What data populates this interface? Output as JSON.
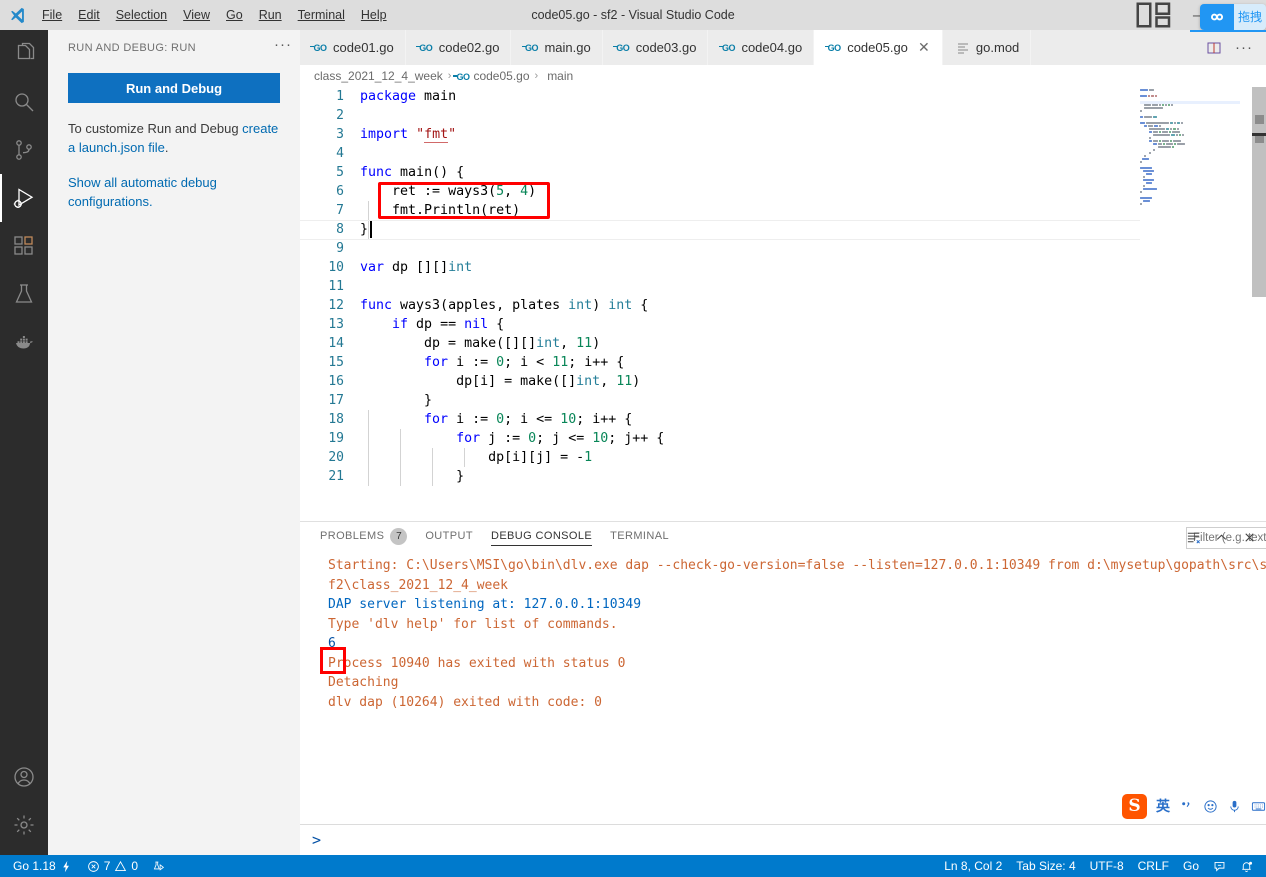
{
  "titlebar": {
    "window_title": "code05.go - sf2 - Visual Studio Code",
    "menus": [
      "File",
      "Edit",
      "Selection",
      "View",
      "Go",
      "Run",
      "Terminal",
      "Help"
    ],
    "layout_icon": "layout-panel-icon",
    "minimize_icon": "minimize-icon",
    "maximize_icon": "maximize-icon",
    "drag_widget": {
      "icon": "cloud-drag-icon",
      "label": "拖拽"
    }
  },
  "activitybar": {
    "items": [
      {
        "name": "explorer",
        "icon": "files-icon",
        "active": false
      },
      {
        "name": "search",
        "icon": "search-icon",
        "active": false
      },
      {
        "name": "source-control",
        "icon": "source-control-icon",
        "active": false
      },
      {
        "name": "run-and-debug",
        "icon": "run-debug-icon",
        "active": true
      },
      {
        "name": "extensions",
        "icon": "extensions-icon",
        "active": false
      },
      {
        "name": "testing",
        "icon": "beaker-icon",
        "active": false
      },
      {
        "name": "docker",
        "icon": "docker-icon",
        "active": false
      }
    ],
    "bottom": [
      {
        "name": "accounts",
        "icon": "account-icon"
      },
      {
        "name": "settings",
        "icon": "gear-icon"
      }
    ]
  },
  "sidebar": {
    "header_title": "RUN AND DEBUG: RUN",
    "more_actions": "···",
    "run_button_label": "Run and Debug",
    "customize_text_1": "To customize Run and Debug ",
    "customize_link": "create a launch.json file",
    "customize_text_2": ".",
    "show_all_link": "Show all automatic debug configurations."
  },
  "tabs": [
    {
      "label": "code01.go",
      "icon": "go-file-icon",
      "active": false,
      "closable": false
    },
    {
      "label": "code02.go",
      "icon": "go-file-icon",
      "active": false,
      "closable": false
    },
    {
      "label": "main.go",
      "icon": "go-file-icon",
      "active": false,
      "closable": false
    },
    {
      "label": "code03.go",
      "icon": "go-file-icon",
      "active": false,
      "closable": false
    },
    {
      "label": "code04.go",
      "icon": "go-file-icon",
      "active": false,
      "closable": false
    },
    {
      "label": "code05.go",
      "icon": "go-file-icon",
      "active": true,
      "closable": true,
      "close_label": "✕"
    },
    {
      "label": "go.mod",
      "icon": "mod-file-icon",
      "active": false,
      "closable": false
    }
  ],
  "tab_actions": [
    {
      "name": "split-editor-button",
      "icon": "split-editor-icon"
    },
    {
      "name": "more-actions-button",
      "icon": "ellipsis-icon",
      "label": "···"
    }
  ],
  "breadcrumbs": [
    {
      "label": "class_2021_12_4_week",
      "icon": ""
    },
    {
      "label": "code05.go",
      "icon": "go-file-icon"
    },
    {
      "label": "main",
      "icon": "symbol-namespace-icon"
    }
  ],
  "editor": {
    "cursor_position": "Ln 8, Col 2",
    "highlight_box": {
      "color": "#ff0000",
      "covers_lines": [
        6,
        7
      ]
    },
    "lines": [
      {
        "n": 1,
        "tokens": [
          {
            "t": "package",
            "c": "kw"
          },
          {
            "t": " main",
            "c": ""
          }
        ]
      },
      {
        "n": 2,
        "tokens": []
      },
      {
        "n": 3,
        "tokens": [
          {
            "t": "import",
            "c": "kw"
          },
          {
            "t": " ",
            "c": ""
          },
          {
            "t": "\"",
            "c": "str"
          },
          {
            "t": "fmt",
            "c": "imp"
          },
          {
            "t": "\"",
            "c": "str"
          }
        ]
      },
      {
        "n": 4,
        "tokens": []
      },
      {
        "n": 5,
        "tokens": [
          {
            "t": "func",
            "c": "kw"
          },
          {
            "t": " ",
            "c": ""
          },
          {
            "t": "main",
            "c": ""
          },
          {
            "t": "() {",
            "c": ""
          }
        ]
      },
      {
        "n": 6,
        "tokens": [
          {
            "t": "    ret := ",
            "c": ""
          },
          {
            "t": "ways3",
            "c": ""
          },
          {
            "t": "(",
            "c": ""
          },
          {
            "t": "5",
            "c": "num"
          },
          {
            "t": ", ",
            "c": ""
          },
          {
            "t": "4",
            "c": "num"
          },
          {
            "t": ")",
            "c": ""
          }
        ]
      },
      {
        "n": 7,
        "tokens": [
          {
            "t": "    fmt.Println(ret)",
            "c": ""
          }
        ]
      },
      {
        "n": 8,
        "tokens": [
          {
            "t": "}",
            "c": ""
          }
        ]
      },
      {
        "n": 9,
        "tokens": []
      },
      {
        "n": 10,
        "tokens": [
          {
            "t": "var",
            "c": "kw"
          },
          {
            "t": " dp [][]",
            "c": ""
          },
          {
            "t": "int",
            "c": "typ"
          }
        ]
      },
      {
        "n": 11,
        "tokens": []
      },
      {
        "n": 12,
        "tokens": [
          {
            "t": "func",
            "c": "kw"
          },
          {
            "t": " ways3(apples, plates ",
            "c": ""
          },
          {
            "t": "int",
            "c": "typ"
          },
          {
            "t": ") ",
            "c": ""
          },
          {
            "t": "int",
            "c": "typ"
          },
          {
            "t": " {",
            "c": ""
          }
        ]
      },
      {
        "n": 13,
        "tokens": [
          {
            "t": "    ",
            "c": ""
          },
          {
            "t": "if",
            "c": "kw"
          },
          {
            "t": " dp == ",
            "c": ""
          },
          {
            "t": "nil",
            "c": "kw"
          },
          {
            "t": " {",
            "c": ""
          }
        ]
      },
      {
        "n": 14,
        "tokens": [
          {
            "t": "        dp = make([][]",
            "c": ""
          },
          {
            "t": "int",
            "c": "typ"
          },
          {
            "t": ", ",
            "c": ""
          },
          {
            "t": "11",
            "c": "num"
          },
          {
            "t": ")",
            "c": ""
          }
        ]
      },
      {
        "n": 15,
        "tokens": [
          {
            "t": "        ",
            "c": ""
          },
          {
            "t": "for",
            "c": "kw"
          },
          {
            "t": " i := ",
            "c": ""
          },
          {
            "t": "0",
            "c": "num"
          },
          {
            "t": "; i < ",
            "c": ""
          },
          {
            "t": "11",
            "c": "num"
          },
          {
            "t": "; i++ {",
            "c": ""
          }
        ]
      },
      {
        "n": 16,
        "tokens": [
          {
            "t": "            dp[i] = make([]",
            "c": ""
          },
          {
            "t": "int",
            "c": "typ"
          },
          {
            "t": ", ",
            "c": ""
          },
          {
            "t": "11",
            "c": "num"
          },
          {
            "t": ")",
            "c": ""
          }
        ]
      },
      {
        "n": 17,
        "tokens": [
          {
            "t": "        }",
            "c": ""
          }
        ]
      },
      {
        "n": 18,
        "tokens": [
          {
            "t": "        ",
            "c": ""
          },
          {
            "t": "for",
            "c": "kw"
          },
          {
            "t": " i := ",
            "c": ""
          },
          {
            "t": "0",
            "c": "num"
          },
          {
            "t": "; i <= ",
            "c": ""
          },
          {
            "t": "10",
            "c": "num"
          },
          {
            "t": "; i++ {",
            "c": ""
          }
        ]
      },
      {
        "n": 19,
        "tokens": [
          {
            "t": "            ",
            "c": ""
          },
          {
            "t": "for",
            "c": "kw"
          },
          {
            "t": " j := ",
            "c": ""
          },
          {
            "t": "0",
            "c": "num"
          },
          {
            "t": "; j <= ",
            "c": ""
          },
          {
            "t": "10",
            "c": "num"
          },
          {
            "t": "; j++ {",
            "c": ""
          }
        ]
      },
      {
        "n": 20,
        "tokens": [
          {
            "t": "                dp[i][j] = -",
            "c": ""
          },
          {
            "t": "1",
            "c": "num"
          }
        ]
      },
      {
        "n": 21,
        "tokens": [
          {
            "t": "            }",
            "c": ""
          }
        ]
      }
    ]
  },
  "panel": {
    "tabs": [
      {
        "label": "PROBLEMS",
        "badge": "7",
        "active": false
      },
      {
        "label": "OUTPUT",
        "badge": null,
        "active": false
      },
      {
        "label": "DEBUG CONSOLE",
        "badge": null,
        "active": true
      },
      {
        "label": "TERMINAL",
        "badge": null,
        "active": false
      }
    ],
    "filter_placeholder": "Filter (e.g. text, !exclude)",
    "filter_value": "",
    "actions": [
      {
        "name": "clear-console-button",
        "icon": "clear-all-icon"
      },
      {
        "name": "collapse-panel-button",
        "icon": "chevron-up-icon"
      },
      {
        "name": "close-panel-button",
        "icon": "close-icon"
      }
    ],
    "console_lines": [
      {
        "text": "Starting: C:\\Users\\MSI\\go\\bin\\dlv.exe dap --check-go-version=false --listen=127.0.0.1:10349 from d:\\mysetup\\gopath\\src\\s",
        "kind": "normal"
      },
      {
        "text": "f2\\class_2021_12_4_week",
        "kind": "normal"
      },
      {
        "text": "DAP server listening at: 127.0.0.1:10349",
        "kind": "info"
      },
      {
        "text": "Type 'dlv help' for list of commands.",
        "kind": "normal"
      },
      {
        "text": "6",
        "kind": "value"
      },
      {
        "text": "Process 10940 has exited with status 0",
        "kind": "normal"
      },
      {
        "text": "Detaching",
        "kind": "normal"
      },
      {
        "text": "dlv dap (10264) exited with code: 0",
        "kind": "normal"
      }
    ],
    "highlighted_output": "6",
    "input_prompt": ">"
  },
  "ime": {
    "logo": "S",
    "mode_label": "英",
    "punctuation_icon": "punctuation-icon",
    "emoji_icon": "emoji-icon",
    "mic_icon": "microphone-icon",
    "keyboard_icon": "keyboard-icon"
  },
  "statusbar": {
    "left": [
      {
        "name": "go-version",
        "label": "Go 1.18",
        "icon": "zap-icon"
      },
      {
        "name": "problems",
        "label": "7",
        "icon": "error-icon",
        "label2": "0",
        "icon2": "warning-icon"
      },
      {
        "name": "go-test",
        "label": "",
        "icon": "beaker-run-icon"
      }
    ],
    "right": [
      {
        "name": "cursor-position",
        "label": "Ln 8, Col 2"
      },
      {
        "name": "tab-size",
        "label": "Tab Size: 4"
      },
      {
        "name": "encoding",
        "label": "UTF-8"
      },
      {
        "name": "eol",
        "label": "CRLF"
      },
      {
        "name": "language-mode",
        "label": "Go"
      },
      {
        "name": "feedback",
        "label": "",
        "icon": "feedback-icon"
      },
      {
        "name": "notifications",
        "label": "",
        "icon": "bell-dot-icon"
      }
    ]
  },
  "colors": {
    "accent": "#007acc",
    "button": "#0e70c0",
    "highlight_red": "#ff0000",
    "link": "#006ab1",
    "console_normal": "#cc6633",
    "console_info": "#0066bf"
  }
}
